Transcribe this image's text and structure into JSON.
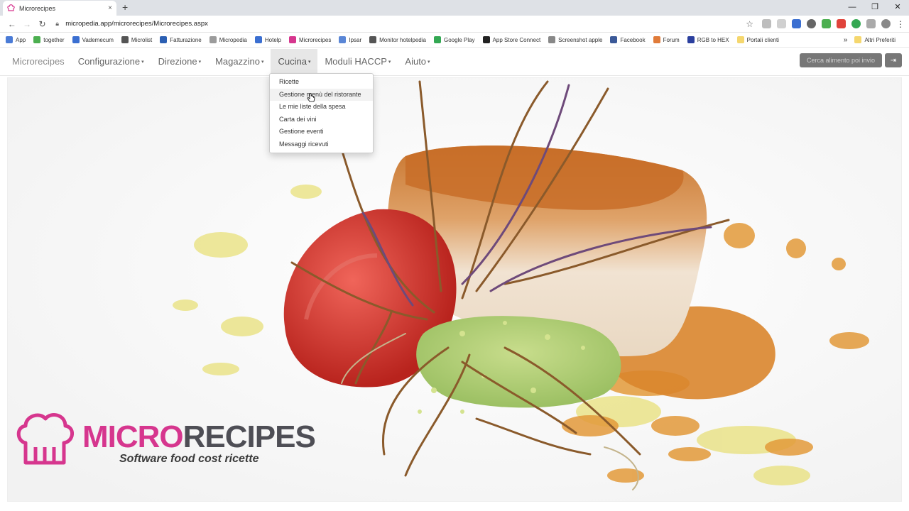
{
  "browser": {
    "tab_title": "Microrecipes",
    "tab_close": "×",
    "new_tab": "+",
    "url": "micropedia.app/microrecipes/Microrecipes.aspx",
    "window_controls": [
      "—",
      "❐",
      "✕"
    ]
  },
  "bookmarks": {
    "items": [
      {
        "label": "App",
        "color": "#4a7bd6"
      },
      {
        "label": "together",
        "color": "#4caf50"
      },
      {
        "label": "Vademecum",
        "color": "#3b6fd1"
      },
      {
        "label": "Microlist",
        "color": "#555555"
      },
      {
        "label": "Fatturazione",
        "color": "#2b5fb3"
      },
      {
        "label": "Micropedia",
        "color": "#9b9b9b"
      },
      {
        "label": "Hotelp",
        "color": "#3b6fd1"
      },
      {
        "label": "Microrecipes",
        "color": "#d6368e"
      },
      {
        "label": "Ipsar",
        "color": "#5a86d6"
      },
      {
        "label": "Monitor hotelpedia",
        "color": "#555555"
      },
      {
        "label": "Google Play",
        "color": "#34a853"
      },
      {
        "label": "App Store Connect",
        "color": "#222222"
      },
      {
        "label": "Screenshot apple",
        "color": "#888888"
      },
      {
        "label": "Facebook",
        "color": "#3b5998"
      },
      {
        "label": "Forum",
        "color": "#e07b39"
      },
      {
        "label": "RGB to HEX",
        "color": "#2b3f9e"
      },
      {
        "label": "Portali clienti",
        "color": "#f5d76e"
      }
    ],
    "more": "»",
    "other_folder": "Altri Preferiti"
  },
  "navbar": {
    "brand": "Microrecipes",
    "items": [
      {
        "label": "Configurazione",
        "active": false
      },
      {
        "label": "Direzione",
        "active": false
      },
      {
        "label": "Magazzino",
        "active": false
      },
      {
        "label": "Cucina",
        "active": true
      },
      {
        "label": "Moduli HACCP",
        "active": false
      },
      {
        "label": "Aiuto",
        "active": false
      }
    ],
    "caret": "▾",
    "search_button": "Cerca alimento poi invio",
    "logout_icon": "⇥"
  },
  "dropdown": {
    "items": [
      "Ricette",
      "Gestione menù del ristorante",
      "Le mie liste della spesa",
      "Carta dei vini",
      "Gestione eventi",
      "Messaggi ricevuti"
    ],
    "hover_index": 1
  },
  "logo": {
    "name_part1": "MICRO",
    "name_part2": "RECIPES",
    "tagline": "Software food cost ricette",
    "color_primary": "#d6368e",
    "color_secondary": "#4e4e55"
  },
  "colors": {
    "chrome_tabstrip": "#dee1e6",
    "button_gray": "#777777",
    "active_nav": "#e7e7e7"
  }
}
